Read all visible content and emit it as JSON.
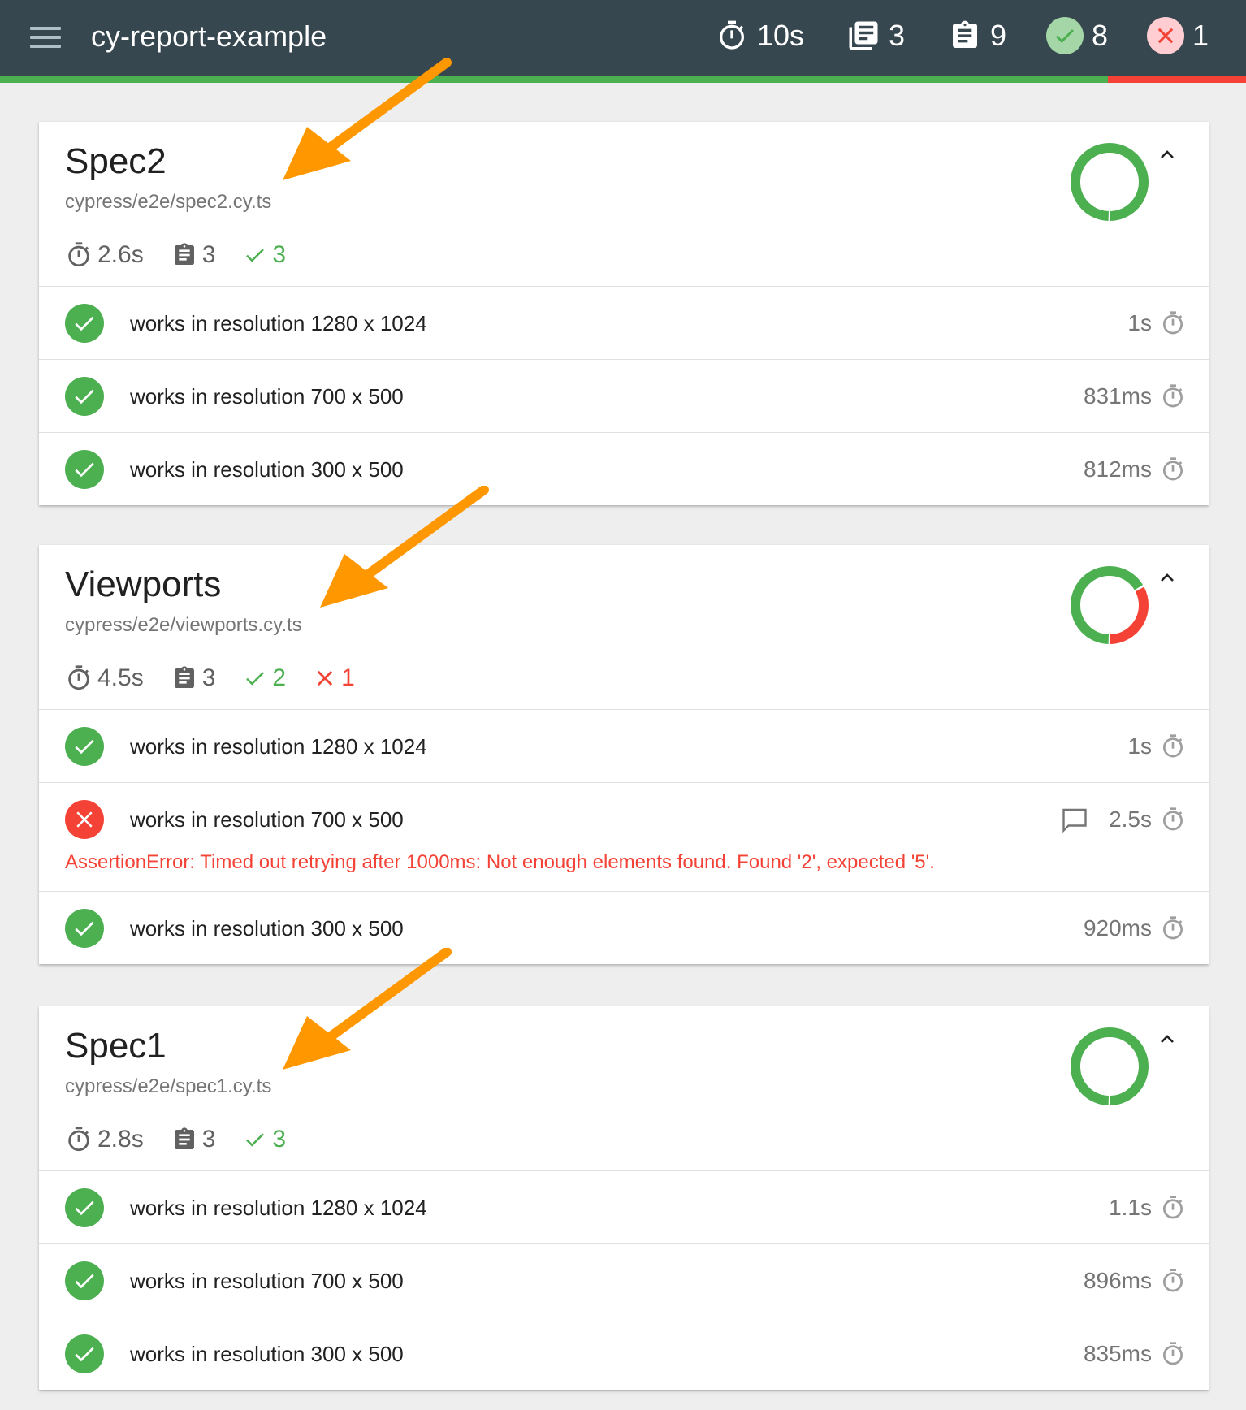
{
  "header": {
    "title": "cy-report-example",
    "duration": "10s",
    "suites": "3",
    "tests": "9",
    "passes": "8",
    "failures": "1",
    "pass_fraction": 0.889
  },
  "colors": {
    "topbar": "#37474f",
    "pass": "#4caf50",
    "fail": "#f44336",
    "annotation": "#ff9800"
  },
  "specs": [
    {
      "title": "Spec2",
      "path": "cypress/e2e/spec2.cy.ts",
      "duration": "2.6s",
      "tests": "3",
      "passes": "3",
      "failures": "",
      "pass_fraction": 1.0,
      "items": [
        {
          "name": "works in resolution 1280 x 1024",
          "duration": "1s",
          "state": "pass"
        },
        {
          "name": "works in resolution 700 x 500",
          "duration": "831ms",
          "state": "pass"
        },
        {
          "name": "works in resolution 300 x 500",
          "duration": "812ms",
          "state": "pass"
        }
      ]
    },
    {
      "title": "Viewports",
      "path": "cypress/e2e/viewports.cy.ts",
      "duration": "4.5s",
      "tests": "3",
      "passes": "2",
      "failures": "1",
      "pass_fraction": 0.667,
      "items": [
        {
          "name": "works in resolution 1280 x 1024",
          "duration": "1s",
          "state": "pass"
        },
        {
          "name": "works in resolution 700 x 500",
          "duration": "2.5s",
          "state": "fail",
          "error": "AssertionError: Timed out retrying after 1000ms: Not enough elements found. Found '2', expected '5'."
        },
        {
          "name": "works in resolution 300 x 500",
          "duration": "920ms",
          "state": "pass"
        }
      ]
    },
    {
      "title": "Spec1",
      "path": "cypress/e2e/spec1.cy.ts",
      "duration": "2.8s",
      "tests": "3",
      "passes": "3",
      "failures": "",
      "pass_fraction": 1.0,
      "items": [
        {
          "name": "works in resolution 1280 x 1024",
          "duration": "1.1s",
          "state": "pass"
        },
        {
          "name": "works in resolution 700 x 500",
          "duration": "896ms",
          "state": "pass"
        },
        {
          "name": "works in resolution 300 x 500",
          "duration": "835ms",
          "state": "pass"
        }
      ]
    }
  ],
  "icons": {
    "menu": "hamburger-menu-icon",
    "duration": "stopwatch-icon",
    "suites": "library-books-icon",
    "tests": "clipboard-icon",
    "pass": "check-icon",
    "fail": "close-icon",
    "collapse": "chevron-up-icon",
    "comment": "comment-icon",
    "annotation": "arrow-icon"
  }
}
